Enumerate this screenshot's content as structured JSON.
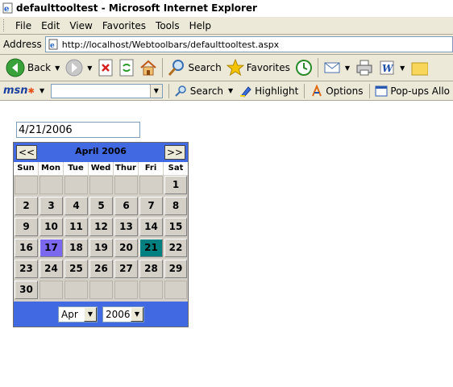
{
  "window": {
    "title": "defaulttooltest - Microsoft Internet Explorer"
  },
  "menu": [
    "File",
    "Edit",
    "View",
    "Favorites",
    "Tools",
    "Help"
  ],
  "address": {
    "label": "Address",
    "url": "http://localhost/Webtoolbars/defaulttooltest.aspx"
  },
  "toolbar": {
    "back": "Back",
    "search": "Search",
    "favorites": "Favorites"
  },
  "msn": {
    "logo": "msn",
    "search": "Search",
    "highlight": "Highlight",
    "options": "Options",
    "popups": "Pop-ups Allo"
  },
  "page": {
    "date_value": "4/21/2006",
    "calendar": {
      "prev_label": "<<",
      "next_label": ">>",
      "month_title": "April 2006",
      "days_of_week": [
        "Sun",
        "Mon",
        "Tue",
        "Wed",
        "Thur",
        "Fri",
        "Sat"
      ],
      "weeks": [
        [
          "",
          "",
          "",
          "",
          "",
          "",
          "1"
        ],
        [
          "2",
          "3",
          "4",
          "5",
          "6",
          "7",
          "8"
        ],
        [
          "9",
          "10",
          "11",
          "12",
          "13",
          "14",
          "15"
        ],
        [
          "16",
          "17",
          "18",
          "19",
          "20",
          "21",
          "22"
        ],
        [
          "23",
          "24",
          "25",
          "26",
          "27",
          "28",
          "29"
        ],
        [
          "30",
          "",
          "",
          "",
          "",
          "",
          ""
        ]
      ],
      "selected_day": "17",
      "highlighted_day": "21",
      "selected_color": "#7b68ee",
      "highlighted_color": "#008080",
      "header_color": "#4169e1",
      "month_select": "Apr",
      "year_select": "2006"
    }
  }
}
